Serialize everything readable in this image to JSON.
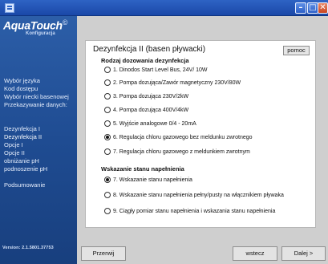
{
  "window": {
    "buttons": {
      "minimize": "–",
      "maximize": "□",
      "close": "✕"
    }
  },
  "sidebar": {
    "logo": {
      "text": "AquaTouch",
      "mark": "©",
      "subtitle": "Konfiguracja"
    },
    "items": [
      {
        "label": "Wybór języka"
      },
      {
        "label": "Kod dostępu"
      },
      {
        "label": "Wybór niecki basenowej"
      },
      {
        "label": "Przekazywanie danych:"
      },
      {
        "label": "Dezynfekcja I"
      },
      {
        "label": "Dezynfekcja II"
      },
      {
        "label": "Opcje I"
      },
      {
        "label": "Opcje II"
      },
      {
        "label": "obniżanie pH"
      },
      {
        "label": "podnoszenie pH"
      },
      {
        "label": "Podsumowanie"
      }
    ],
    "active_item": "Dezynfekcja II",
    "version": "Version: 2.1.5801.37753"
  },
  "main": {
    "title": "Dezynfekcja II (basen pływacki)",
    "help_label": "pomoc",
    "dosing": {
      "title": "Rodzaj  dozowania dezynfekcja",
      "options": [
        {
          "label": "1. Dinodos Start Level Bus, 24V/ 10W",
          "checked": false
        },
        {
          "label": "2. Pompa dozująca/Zawór magnetyczny 230V/80W",
          "checked": false
        },
        {
          "label": "3. Pompa dozująca 230V/2kW",
          "checked": false
        },
        {
          "label": "4. Pompa dozująca 400V/4kW",
          "checked": false
        },
        {
          "label": "5. Wyjście analogowe 0/4 - 20mA",
          "checked": false
        },
        {
          "label": "6. Regulacja chloru gazowego bez meldunku zwrotnego",
          "checked": true
        },
        {
          "label": "7. Regulacja chloru gazowego z meldunkiem zwrotnym",
          "checked": false
        }
      ]
    },
    "level": {
      "title": "Wskazanie stanu napełnienia",
      "options": [
        {
          "label": "7. Wskazanie stanu napełnienia",
          "checked": true
        },
        {
          "label": "8. Wskazanie stanu napełnienia pełny/pusty na włącznikiem pływaka",
          "checked": false
        },
        {
          "label": "9. Ciągły pomiar stanu napełnienia i wskazania stanu napełnienia",
          "checked": false
        }
      ]
    }
  },
  "footer": {
    "print_label": "Przerwij",
    "back_label": "wstecz",
    "next_label": "Dalej >"
  }
}
